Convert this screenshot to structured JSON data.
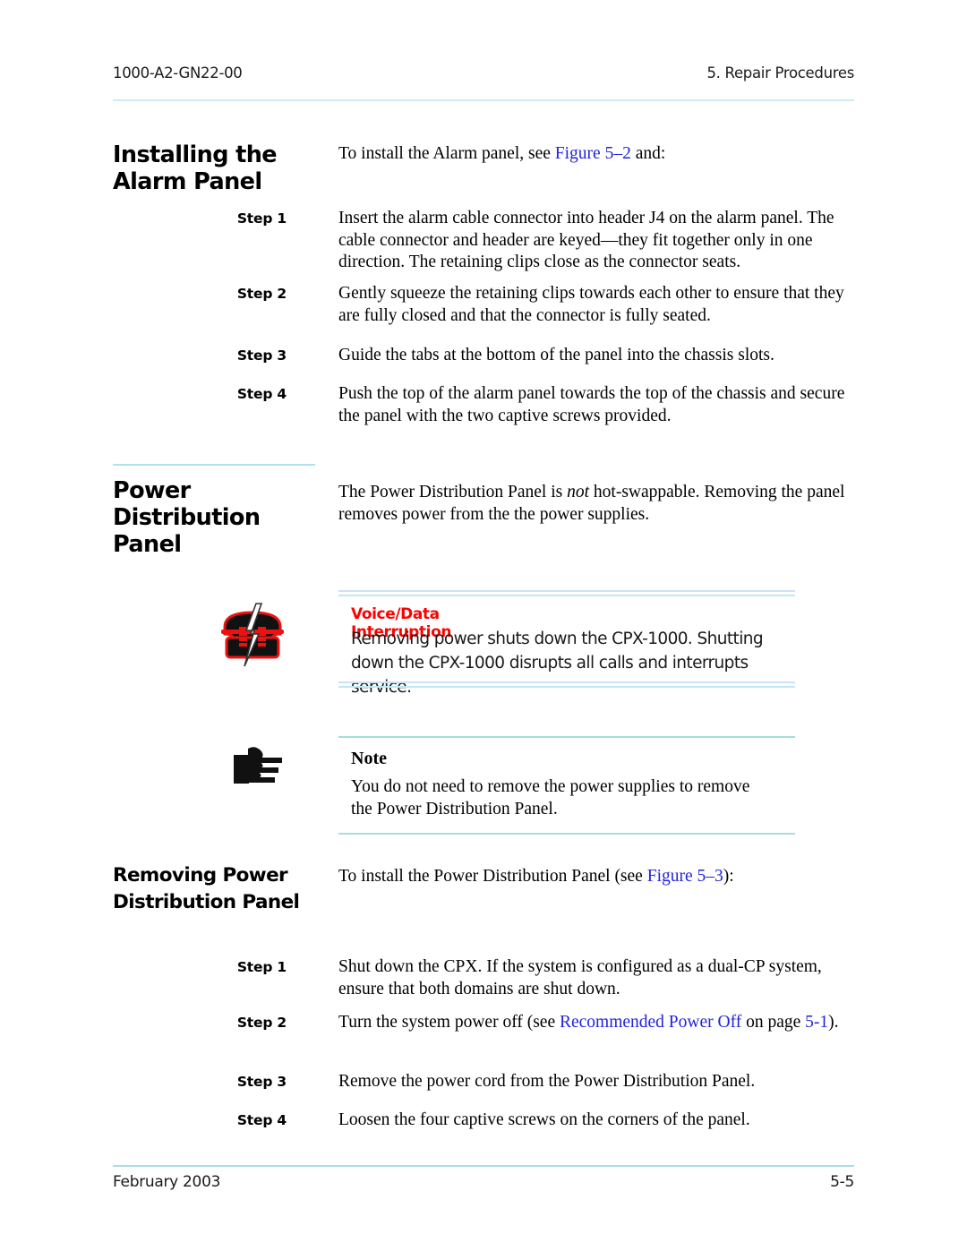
{
  "header": {
    "doc_number": "1000-A2-GN22-00",
    "chapter": "5. Repair Procedures"
  },
  "footer": {
    "date": "February 2003",
    "page_number": "5-5"
  },
  "colors": {
    "link": "#2222dd",
    "warning_title": "#ff0000",
    "rule_blue": "#aee3ee",
    "rule_teal": "#a6dfd9"
  },
  "sections": [
    {
      "id": "installing-alarm-panel",
      "heading": "Installing the Alarm Panel",
      "intro_pre": "To install the Alarm panel, see ",
      "intro_link": "Figure 5–2",
      "intro_post": " and:",
      "steps": [
        {
          "label": "Step 1",
          "text": "Insert the alarm cable connector into header J4 on the alarm panel. The cable connector and header are keyed—they fit together only in one direction. The retaining clips close as the connector seats."
        },
        {
          "label": "Step 2",
          "text": "Gently squeeze the retaining clips towards each other to ensure that they are fully closed and that the connector is fully seated."
        },
        {
          "label": "Step 3",
          "text": "Guide the tabs at the bottom of the panel into the chassis slots."
        },
        {
          "label": "Step 4",
          "text": "Push the top of the alarm panel towards the top of the chassis and secure the panel with the two captive screws provided."
        }
      ]
    },
    {
      "id": "power-distribution-panel",
      "heading": "Power Distribution Panel",
      "intro_a": "The Power Distribution Panel is ",
      "intro_italic": "not",
      "intro_b": " hot-swappable. Removing the panel removes power from the the power supplies."
    },
    {
      "id": "removing-power-distribution-panel",
      "heading": "Removing Power Distribution Panel",
      "intro_pre": "To install the Power Distribution Panel (see ",
      "intro_link": "Figure 5–3",
      "intro_post": "):",
      "steps": [
        {
          "label": "Step 1",
          "text_pre": "Shut down the CPX. If the system is configured as a dual-CP system, ensure that both domains are shut down."
        },
        {
          "label": "Step 2",
          "text_pre": "Turn the system power off (see ",
          "link1": "Recommended Power Off",
          "text_mid": " on page ",
          "link2": "5-1",
          "text_post": ")."
        },
        {
          "label": "Step 3",
          "text_pre": "Remove the power cord from the Power Distribution Panel."
        },
        {
          "label": "Step 4",
          "text_pre": "Loosen the four captive screws on the corners of the panel."
        }
      ]
    }
  ],
  "admonitions": {
    "warning": {
      "icon": "broken-telephone-icon",
      "title": "Voice/Data Interruption",
      "body": "Removing power shuts down the CPX-1000. Shutting down the CPX-1000 disrupts all calls and interrupts service."
    },
    "note": {
      "icon": "pointing-hand-icon",
      "title": "Note",
      "body": "You do not need to remove the power supplies to remove the Power Distribution Panel."
    }
  }
}
